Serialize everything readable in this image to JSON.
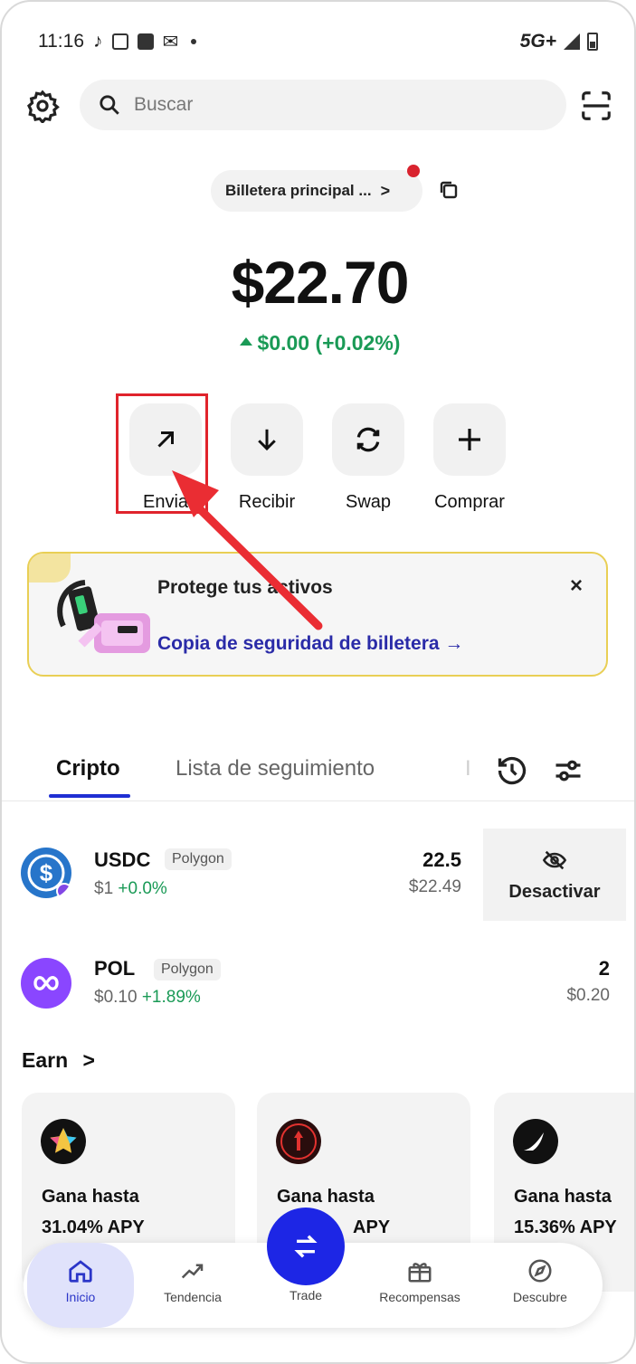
{
  "status_bar": {
    "time": "11:16",
    "network": "5G+"
  },
  "header": {
    "search_placeholder": "Buscar"
  },
  "wallet": {
    "name": "Billetera principal ...",
    "chevron": ">"
  },
  "balance": {
    "amount": "$22.70",
    "change": "$0.00 (+0.02%)"
  },
  "actions": [
    {
      "label": "Enviar"
    },
    {
      "label": "Recibir"
    },
    {
      "label": "Swap"
    },
    {
      "label": "Comprar"
    }
  ],
  "action_labels_visible": {
    "send_partial": "Envia"
  },
  "banner": {
    "title": "Protege tus activos",
    "link": "Copia de seguridad de billetera →",
    "close": "×"
  },
  "tabs": [
    {
      "label": "Cripto"
    },
    {
      "label": "Lista de seguimiento"
    }
  ],
  "tokens": [
    {
      "symbol": "USDC",
      "chain": "Polygon",
      "price": "$1",
      "change": "+0.0%",
      "amount": "22.5",
      "value": "$22.49"
    },
    {
      "symbol": "POL",
      "chain": "Polygon",
      "price": "$0.10",
      "change": "+1.89%",
      "amount": "2",
      "value": "$0.20"
    }
  ],
  "deactivate": {
    "label": "Desactivar"
  },
  "earn": {
    "title": "Earn",
    "chevron": ">",
    "cards": [
      {
        "line1": "Gana hasta",
        "line2": "31.04% APY"
      },
      {
        "line1": "Gana hasta",
        "line2": "APY"
      },
      {
        "line1": "Gana hasta",
        "line2": "15.36% APY"
      }
    ]
  },
  "bottom_nav": [
    {
      "label": "Inicio"
    },
    {
      "label": "Tendencia"
    },
    {
      "label": "Trade"
    },
    {
      "label": "Recompensas"
    },
    {
      "label": "Descubre"
    }
  ],
  "colors": {
    "accent": "#1d26e5",
    "positive": "#1a9a56",
    "highlight": "#e0242c",
    "banner_border": "#e9cf55"
  }
}
